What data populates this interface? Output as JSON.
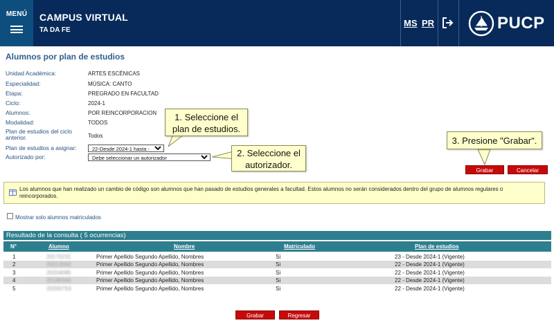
{
  "header": {
    "menu_label": "MENÚ",
    "app_title": "CAMPUS VIRTUAL",
    "app_subtitle": "TA DA FE",
    "link_ms": "MS",
    "link_pr": "PR",
    "logo_text": "PUCP",
    "colors": {
      "bg": "#072A5A",
      "menu_bg": "#0E4E7E"
    }
  },
  "page": {
    "title": "Alumnos por plan de estudios"
  },
  "info": {
    "rows": [
      {
        "label": "Unidad Académica:",
        "value": "ARTES ESCÉNICAS"
      },
      {
        "label": "Especialidad:",
        "value": "MÚSICA: CANTO"
      },
      {
        "label": "Etapa:",
        "value": "PREGRADO EN FACULTAD"
      },
      {
        "label": "Ciclo:",
        "value": "2024-1"
      },
      {
        "label": "Alumnos:",
        "value": "POR REINCORPORACION"
      },
      {
        "label": "Modalidad:",
        "value": "TODOS"
      }
    ],
    "plan_ciclo_label": "Plan de estudios del ciclo anterior.",
    "plan_ciclo_value": "Todos",
    "plan_asignar_label": "Plan de estudios a asignar:",
    "plan_asignar_value": "22-Desde 2024-1 hasta -",
    "autorizado_label": "Autorizado por:",
    "autorizado_value": "Debe seleccionar un autorizador"
  },
  "callouts": {
    "c1": "1. Seleccione el plan de estudios.",
    "c2": "2. Seleccione el autorizador.",
    "c3": "3. Presione \"Grabar\"."
  },
  "buttons": {
    "grabar": "Grabar",
    "cancelar": "Cancelar",
    "regresar": "Regresar",
    "color": "#C60A0A"
  },
  "notice": {
    "text": "Los alumnos que han realizado un cambio de código son alumnos que han pasado de estudios generales a facultad. Estos alumnos no serán considerados dentro del grupo de alumnos regulares o reincorporados."
  },
  "filter": {
    "label": "Mostrar solo alumnos matriculados",
    "checked": false
  },
  "results": {
    "title": "Resultado de la consulta ( 5 ocurrencias)",
    "columns": [
      "N°",
      "Alumno",
      "Nombre",
      "Matriculado",
      "Plan de estudios"
    ],
    "rows": [
      {
        "n": "1",
        "alumno": "20170231",
        "nombre": "Primer Apellido Segundo Apellido, Nombres",
        "matriculado": "Si",
        "plan": "23 - Desde 2024-1 (Vigente)"
      },
      {
        "n": "2",
        "alumno": "20213592",
        "nombre": "Primer Apellido Segundo Apellido, Nombres",
        "matriculado": "Si",
        "plan": "22 - Desde 2024-1 (Vigente)"
      },
      {
        "n": "3",
        "alumno": "20204085",
        "nombre": "Primer Apellido Segundo Apellido, Nombres",
        "matriculado": "Si",
        "plan": "22 - Desde 2024-1 (Vigente)"
      },
      {
        "n": "4",
        "alumno": "20186340",
        "nombre": "Primer Apellido Segundo Apellido, Nombres",
        "matriculado": "Si",
        "plan": "22 - Desde 2024-1 (Vigente)"
      },
      {
        "n": "5",
        "alumno": "20200753",
        "nombre": "Primer Apellido Segundo Apellido, Nombres",
        "matriculado": "Si",
        "plan": "22 - Desde 2024-1 (Vigente)"
      }
    ],
    "colors": {
      "header": "#2D7F8F",
      "alt_row": "#DCDCDC"
    }
  }
}
